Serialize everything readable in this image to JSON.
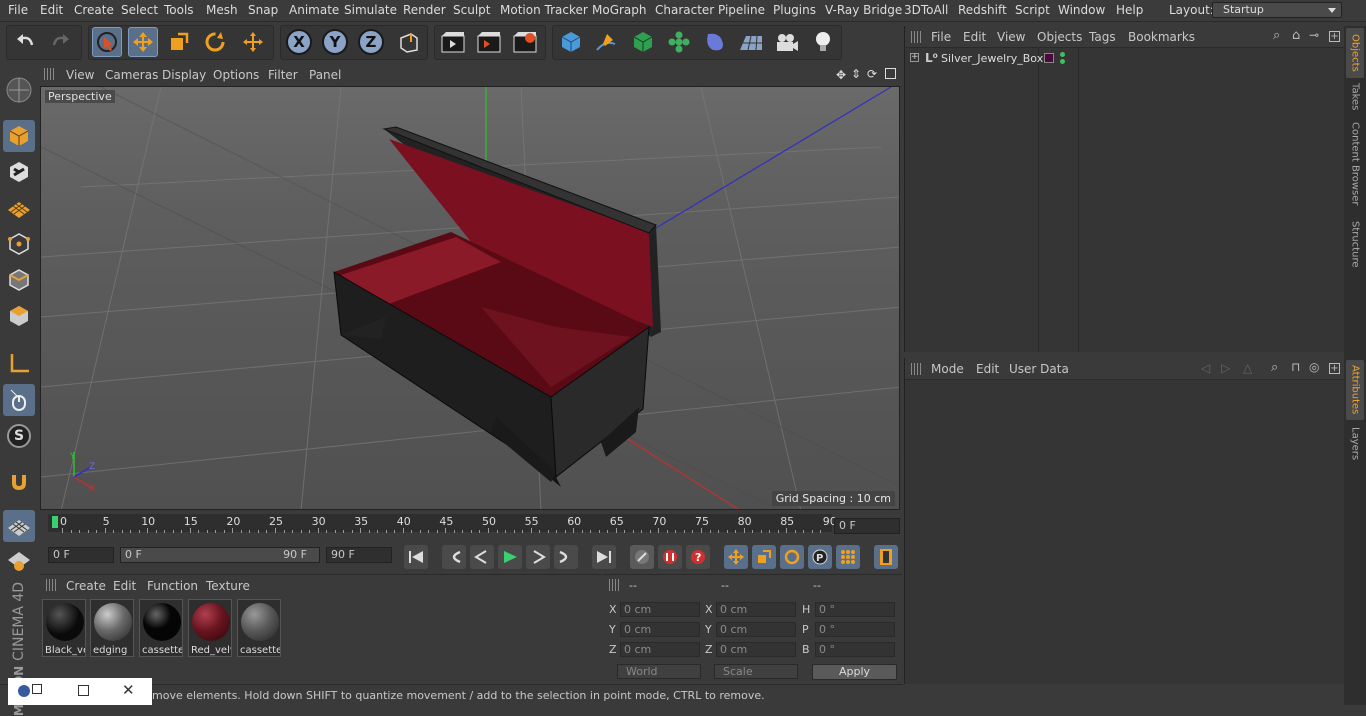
{
  "menubar": {
    "items": [
      "File",
      "Edit",
      "Create",
      "Select",
      "Tools",
      "Mesh",
      "Snap",
      "Animate",
      "Simulate",
      "Render",
      "Sculpt",
      "Motion Tracker",
      "MoGraph",
      "Character",
      "Pipeline",
      "Plugins",
      "V-Ray Bridge",
      "3DToAll",
      "Redshift",
      "Script",
      "Window",
      "Help"
    ],
    "layout_label": "Layout:",
    "layout_value": "Startup"
  },
  "viewport": {
    "menu": [
      "View",
      "Cameras",
      "Display",
      "Options",
      "Filter",
      "Panel"
    ],
    "camera_label": "Perspective",
    "grid_spacing": "Grid Spacing : 10 cm"
  },
  "timeline": {
    "ticks": [
      "0",
      "5",
      "10",
      "15",
      "20",
      "25",
      "30",
      "35",
      "40",
      "45",
      "50",
      "55",
      "60",
      "65",
      "70",
      "75",
      "80",
      "85",
      "90"
    ],
    "current_frame": "0 F"
  },
  "transport": {
    "start_frame": "0 F",
    "range_start": "0 F",
    "range_end": "90 F",
    "end_frame": "90 F"
  },
  "materials": {
    "menu": [
      "Create",
      "Edit",
      "Function",
      "Texture"
    ],
    "items": [
      {
        "label": "Black_ve",
        "color": "#0a0a0a"
      },
      {
        "label": "edging",
        "color": "#6a6a6a"
      },
      {
        "label": "cassette",
        "color": "#050505"
      },
      {
        "label": "Red_velv",
        "color": "#6a1520"
      },
      {
        "label": "cassette",
        "color": "#5a5a5a"
      }
    ]
  },
  "coordinates": {
    "headers": [
      "--",
      "--",
      "--"
    ],
    "rows": [
      {
        "a": "X",
        "av": "0 cm",
        "b": "X",
        "bv": "0 cm",
        "c": "H",
        "cv": "0 °"
      },
      {
        "a": "Y",
        "av": "0 cm",
        "b": "Y",
        "bv": "0 cm",
        "c": "P",
        "cv": "0 °"
      },
      {
        "a": "Z",
        "av": "0 cm",
        "b": "Z",
        "bv": "0 cm",
        "c": "B",
        "cv": "0 °"
      }
    ],
    "mode_select": "World",
    "scale_select": "Scale",
    "apply_label": "Apply"
  },
  "status": {
    "text": "move elements. Hold down SHIFT to quantize movement / add to the selection in point mode, CTRL to remove."
  },
  "objects": {
    "menu": [
      "File",
      "Edit",
      "View",
      "Objects",
      "Tags",
      "Bookmarks"
    ],
    "items": [
      {
        "name": "Silver_Jewelry_Box"
      }
    ]
  },
  "attributes": {
    "menu": [
      "Mode",
      "Edit",
      "User Data"
    ]
  },
  "sidetabs": [
    "Objects",
    "Takes",
    "Content Browser",
    "Structure",
    "Attributes",
    "Layers"
  ],
  "brand": {
    "maxon": "MAXON",
    "product": "CINEMA 4D"
  },
  "colors": {
    "accent": "#5a6f8a",
    "axis_x": "#c03030",
    "axis_y": "#30c030",
    "axis_z": "#3030c0",
    "velvet": "#7a1020"
  }
}
